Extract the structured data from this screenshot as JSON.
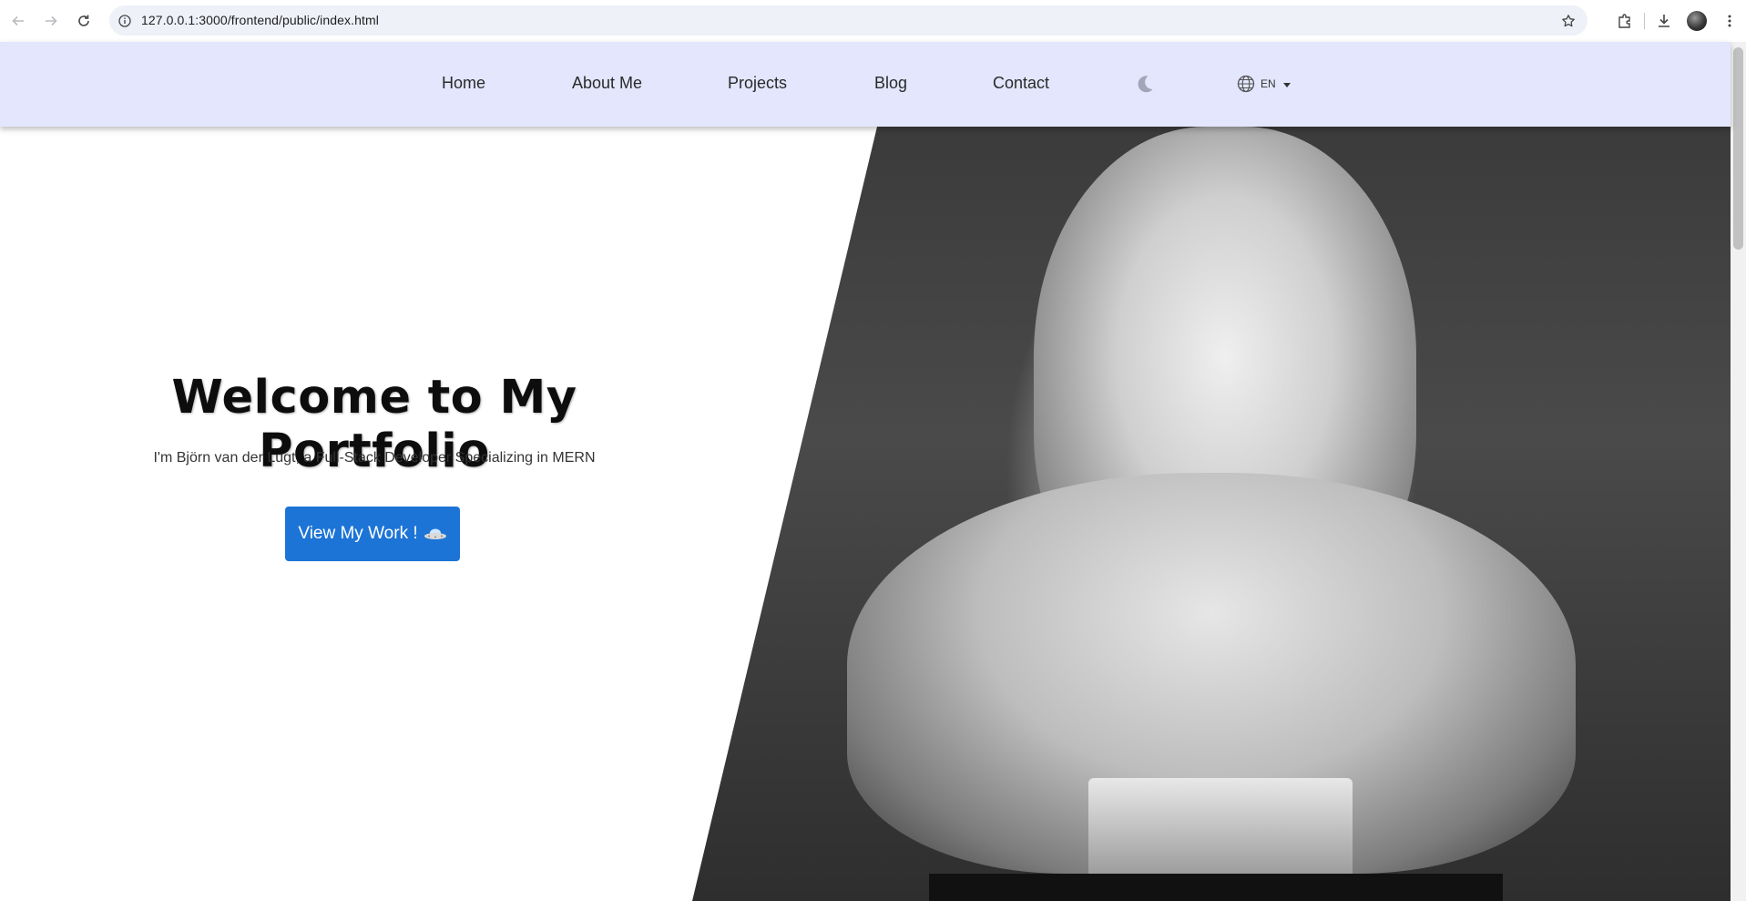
{
  "browser": {
    "url": "127.0.0.1:3000/frontend/public/index.html"
  },
  "nav": {
    "links": [
      "Home",
      "About Me",
      "Projects",
      "Blog",
      "Contact"
    ],
    "language_label": "EN"
  },
  "hero": {
    "title": "Welcome to My Portfolio",
    "subtitle": "I'm Björn van der Lugt, a Full-Stack Developer Specializing in MERN",
    "cta_label": "View My Work !"
  },
  "colors": {
    "nav_background": "#e3e6fd",
    "cta_background": "#1c74d6"
  }
}
